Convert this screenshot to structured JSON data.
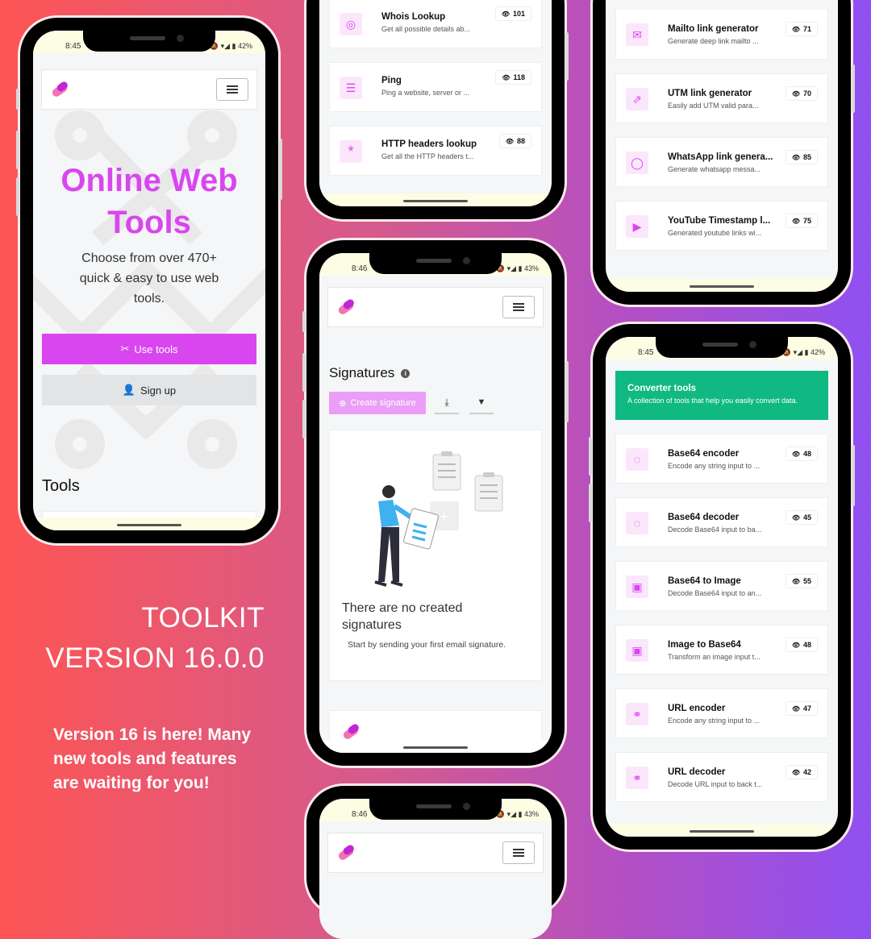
{
  "status": {
    "p1": {
      "time": "8:45",
      "battery": "42%"
    },
    "p3": {
      "time": "8:46",
      "battery": "43%"
    },
    "p5": {
      "time": "8:45",
      "battery": "42%"
    },
    "p6": {
      "time": "8:46",
      "battery": "43%"
    }
  },
  "phone1": {
    "hero_title": "Online Web Tools",
    "hero_subtitle": "Choose from over 470+ quick & easy to use web tools.",
    "use_tools_label": "Use tools",
    "sign_up_label": "Sign up",
    "tools_heading": "Tools"
  },
  "phone2": {
    "items": [
      {
        "title": "Whois Lookup",
        "desc": "Get all possible details ab...",
        "views": "101"
      },
      {
        "title": "Ping",
        "desc": "Ping a website, server or ...",
        "views": "118"
      },
      {
        "title": "HTTP headers lookup",
        "desc": "Get all the HTTP headers t...",
        "views": "88"
      }
    ]
  },
  "phone3": {
    "title": "Signatures",
    "create_label": "Create signature",
    "empty_title": "There are no created signatures",
    "empty_desc": "Start by sending your first email signature."
  },
  "phone4": {
    "items": [
      {
        "title": "Mailto link generator",
        "desc": "Generate deep link mailto ...",
        "views": "71"
      },
      {
        "title": "UTM link generator",
        "desc": "Easily add UTM valid para...",
        "views": "70"
      },
      {
        "title": "WhatsApp link genera...",
        "desc": "Generate whatsapp messa...",
        "views": "85"
      },
      {
        "title": "YouTube Timestamp l...",
        "desc": "Generated youtube links wi...",
        "views": "75"
      }
    ]
  },
  "phone5": {
    "banner_title": "Converter tools",
    "banner_desc": "A collection of tools that help you easily convert data.",
    "items": [
      {
        "title": "Base64 encoder",
        "desc": "Encode any string input to ...",
        "views": "48"
      },
      {
        "title": "Base64 decoder",
        "desc": "Decode Base64 input to ba...",
        "views": "45"
      },
      {
        "title": "Base64 to Image",
        "desc": "Decode Base64 input to an...",
        "views": "55"
      },
      {
        "title": "Image to Base64",
        "desc": "Transform an image input t...",
        "views": "48"
      },
      {
        "title": "URL encoder",
        "desc": "Encode any string input to ...",
        "views": "47"
      },
      {
        "title": "URL decoder",
        "desc": "Decode URL input to back t...",
        "views": "42"
      }
    ]
  },
  "promo": {
    "line1": "TOOLKIT",
    "line2": "VERSION 16.0.0",
    "body": "Version 16 is here! Many new tools and features are waiting for you!"
  },
  "colors": {
    "accent": "#d946ef",
    "converter_banner": "#10b981"
  }
}
